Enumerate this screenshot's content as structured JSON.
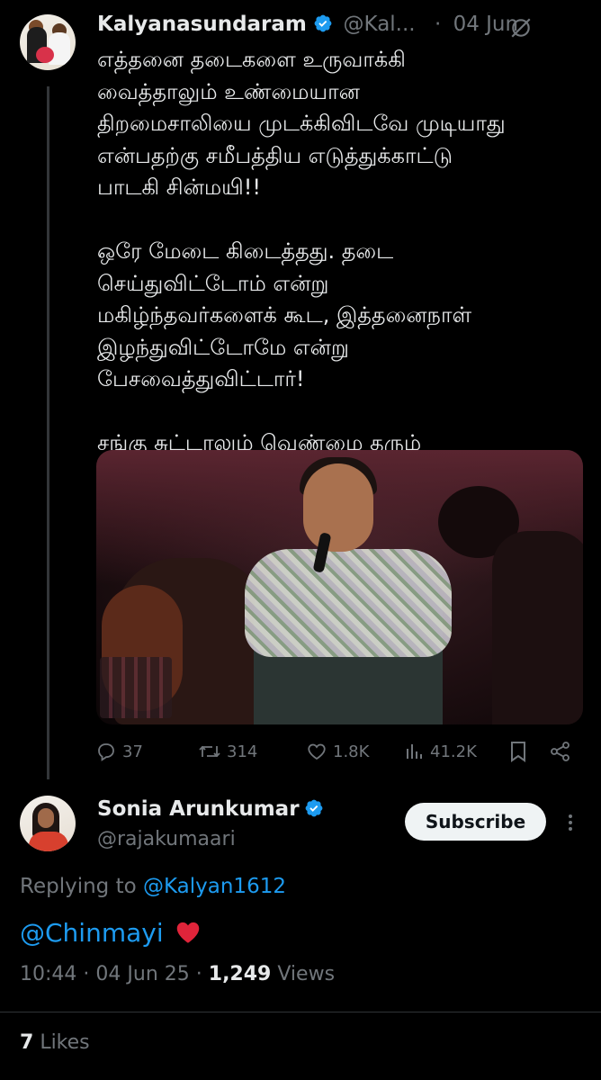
{
  "tweet": {
    "author_name": "Kalyanasundaram",
    "handle": "@Kal...",
    "separator": "·",
    "date": "04 Jun",
    "text": "எத்தனை தடைகளை உருவாக்கி\nவைத்தாலும் உண்மையான\nதிறமைசாலியை முடக்கிவிடவே முடியாது\nஎன்பதற்கு சமீபத்திய எடுத்துக்காட்டு\nபாடகி சின்மயி!!\n\nஒரே மேடை கிடைத்தது. தடை\nசெய்துவிட்டோம் என்று\nமகிழ்ந்தவர்களைக் கூட, இத்தனைநாள்\nஇழந்துவிட்டோமே என்று\nபேசவைத்துவிட்டார்!\n\nசங்கு சுட்டாலும் வெண்மை தரும்",
    "actions": {
      "replies": "37",
      "reposts": "314",
      "likes": "1.8K",
      "views": "41.2K"
    }
  },
  "reply": {
    "author_name": "Sonia Arunkumar",
    "handle": "@rajakumaari",
    "subscribe_label": "Subscribe",
    "replying_prefix": "Replying to",
    "replying_to": "@Kalyan1612",
    "text": "@Chinmayi",
    "time": "10:44",
    "dot": "·",
    "date": "04 Jun 25",
    "views_count": "1,249",
    "views_label": "Views",
    "likes_count": "7",
    "likes_label": "Likes"
  },
  "colors": {
    "background": "#000000",
    "text": "#e7e9ea",
    "muted": "#71767b",
    "accent": "#1d9bf0",
    "heart": "#f91880"
  },
  "icons": [
    "verified-badge-icon",
    "grok-icon",
    "reply-icon",
    "repost-icon",
    "like-icon",
    "views-icon",
    "bookmark-icon",
    "share-icon",
    "more-icon",
    "heart-emoji"
  ]
}
